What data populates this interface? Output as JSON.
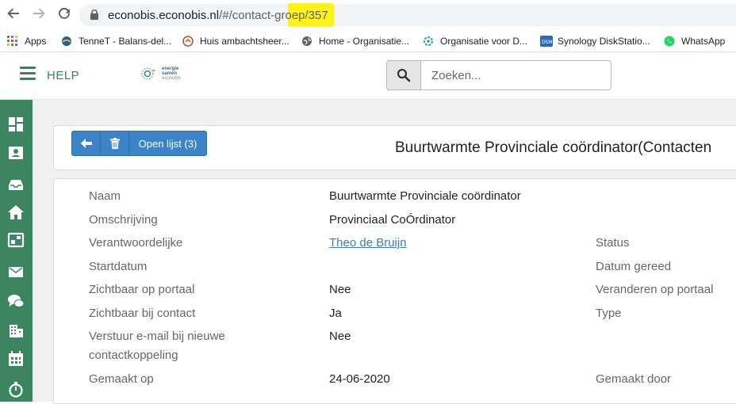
{
  "browser": {
    "url_host": "econobis.econobis.nl",
    "url_path": "/#/contact-groep/357"
  },
  "bookmarks": [
    {
      "label": "Apps",
      "icon": "apps-grid-icon"
    },
    {
      "label": "TenneT - Balans-del...",
      "icon": "tennet-icon"
    },
    {
      "label": "Huis ambachtsheer...",
      "icon": "house-icon"
    },
    {
      "label": "Home - Organisatie...",
      "icon": "globe-icon"
    },
    {
      "label": "Organisatie voor D...",
      "icon": "organisation-icon"
    },
    {
      "label": "Synology DiskStatio...",
      "icon": "dsm-icon"
    },
    {
      "label": "WhatsApp",
      "icon": "whatsapp-icon"
    }
  ],
  "header": {
    "help_label": "HELP",
    "logo_text": "energie samen",
    "logo_sub": "econobis",
    "search_placeholder": "Zoeken..."
  },
  "toolbar": {
    "open_list_label": "Open lijst (3)"
  },
  "page": {
    "title": "Buurtwarmte Provinciale coördinator(Contacten"
  },
  "details": {
    "naam_label": "Naam",
    "naam_value": "Buurtwarmte Provinciale coördinator",
    "omschrijving_label": "Omschrijving",
    "omschrijving_value": "Provinciaal CoÓrdinator",
    "verantwoordelijke_label": "Verantwoordelijke",
    "verantwoordelijke_value": "Theo de Bruijn",
    "status_label": "Status",
    "startdatum_label": "Startdatum",
    "datum_gereed_label": "Datum gereed",
    "zichtbaar_portaal_label": "Zichtbaar op portaal",
    "zichtbaar_portaal_value": "Nee",
    "veranderen_portaal_label": "Veranderen op portaal",
    "zichtbaar_contact_label": "Zichtbaar bij contact",
    "zichtbaar_contact_value": "Ja",
    "type_label": "Type",
    "verstuur_label_1": "Verstuur e-mail bij nieuwe",
    "verstuur_label_2": "contactkoppeling",
    "verstuur_value": "Nee",
    "gemaakt_op_label": "Gemaakt op",
    "gemaakt_op_value": "24-06-2020",
    "gemaakt_door_label": "Gemaakt door"
  },
  "colors": {
    "sidebar": "#3d8560",
    "primary_button": "#3c83c7",
    "url_highlight": "#fff200"
  }
}
